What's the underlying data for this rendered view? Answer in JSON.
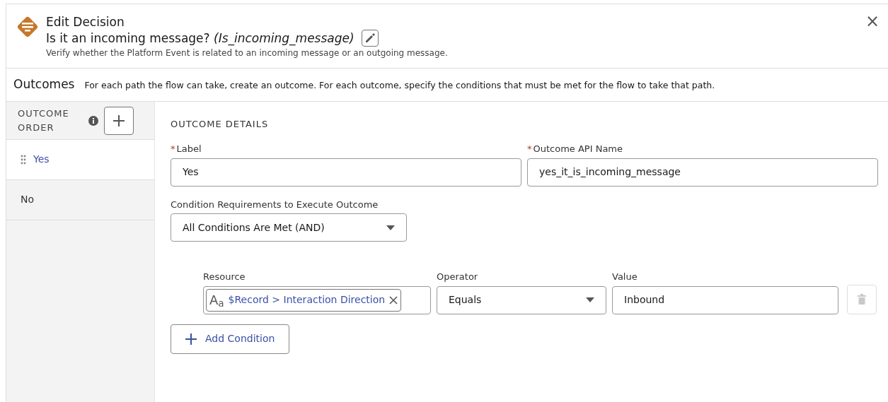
{
  "header": {
    "title": "Edit Decision",
    "label": "Is it an incoming message?",
    "api_name": "(Is_incoming_message)",
    "description": "Verify whether the Platform Event is related to an incoming message or an outgoing message.",
    "close": "×"
  },
  "outcomes_bar": {
    "title": "Outcomes",
    "text": "For each path the flow can take, create an outcome. For each outcome, specify the conditions that must be met for the flow to take that path."
  },
  "sidebar": {
    "heading": "OUTCOME ORDER",
    "items": [
      {
        "label": "Yes",
        "selected": true,
        "draggable": true
      },
      {
        "label": "No",
        "selected": false,
        "draggable": false
      }
    ]
  },
  "details": {
    "heading": "OUTCOME DETAILS",
    "label_field": {
      "required_mark": "*",
      "label": "Label",
      "value": "Yes"
    },
    "api_field": {
      "required_mark": "*",
      "label": "Outcome API Name",
      "value": "yes_it_is_incoming_message"
    },
    "requirement": {
      "label": "Condition Requirements to Execute Outcome",
      "value": "All Conditions Are Met (AND)"
    },
    "conditions": [
      {
        "resource_label": "Resource",
        "type_glyph": "A$_{a}$",
        "resource": "$Record > Interaction Direction",
        "operator_label": "Operator",
        "operator": "Equals",
        "value_label": "Value",
        "value": "Inbound",
        "delete_disabled": true
      }
    ],
    "add_button": "Add Condition"
  }
}
